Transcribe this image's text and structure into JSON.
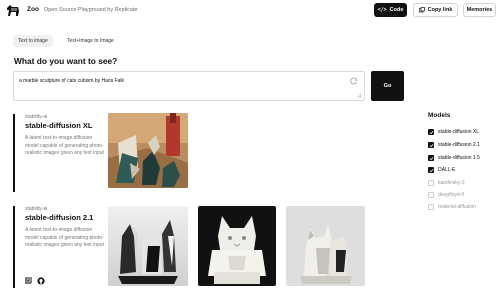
{
  "header": {
    "brand": "Zoo",
    "tagline": "Open Source Playground by Replicate",
    "code_label": "Code",
    "copy_label": "Copy link",
    "memories_label": "Memories"
  },
  "tabs": [
    {
      "label": "Text to image",
      "active": true
    },
    {
      "label": "Text+Image to Image",
      "active": false
    }
  ],
  "question": "What do you want to see?",
  "prompt": {
    "value": "a marble sculpture of cats cubism by Hans Falk"
  },
  "go_label": "Go",
  "models": [
    {
      "owner": "stability-ai",
      "name": "stable-diffusion XL",
      "description": "A latent text-to-image diffusion model capable of generating photo-realistic images given any text input",
      "images": 1
    },
    {
      "owner": "stability-ai",
      "name": "stable-diffusion 2.1",
      "description": "A latent text-to-image diffusion model capable of generating photo-realistic images given any text input",
      "images": 3
    }
  ],
  "sidebar": {
    "title": "Models",
    "options": [
      {
        "label": "stable-diffusion XL",
        "checked": true
      },
      {
        "label": "stable-diffusion 2.1",
        "checked": true
      },
      {
        "label": "stable-diffusion 1.5",
        "checked": true
      },
      {
        "label": "DALL-E",
        "checked": true
      },
      {
        "label": "kandinsky-2",
        "checked": false
      },
      {
        "label": "deepfloyd-if",
        "checked": false
      },
      {
        "label": "material-diffusion",
        "checked": false
      }
    ]
  },
  "colors": {
    "accent": "#111111",
    "border": "#d9d9d9",
    "muted": "#777777"
  }
}
